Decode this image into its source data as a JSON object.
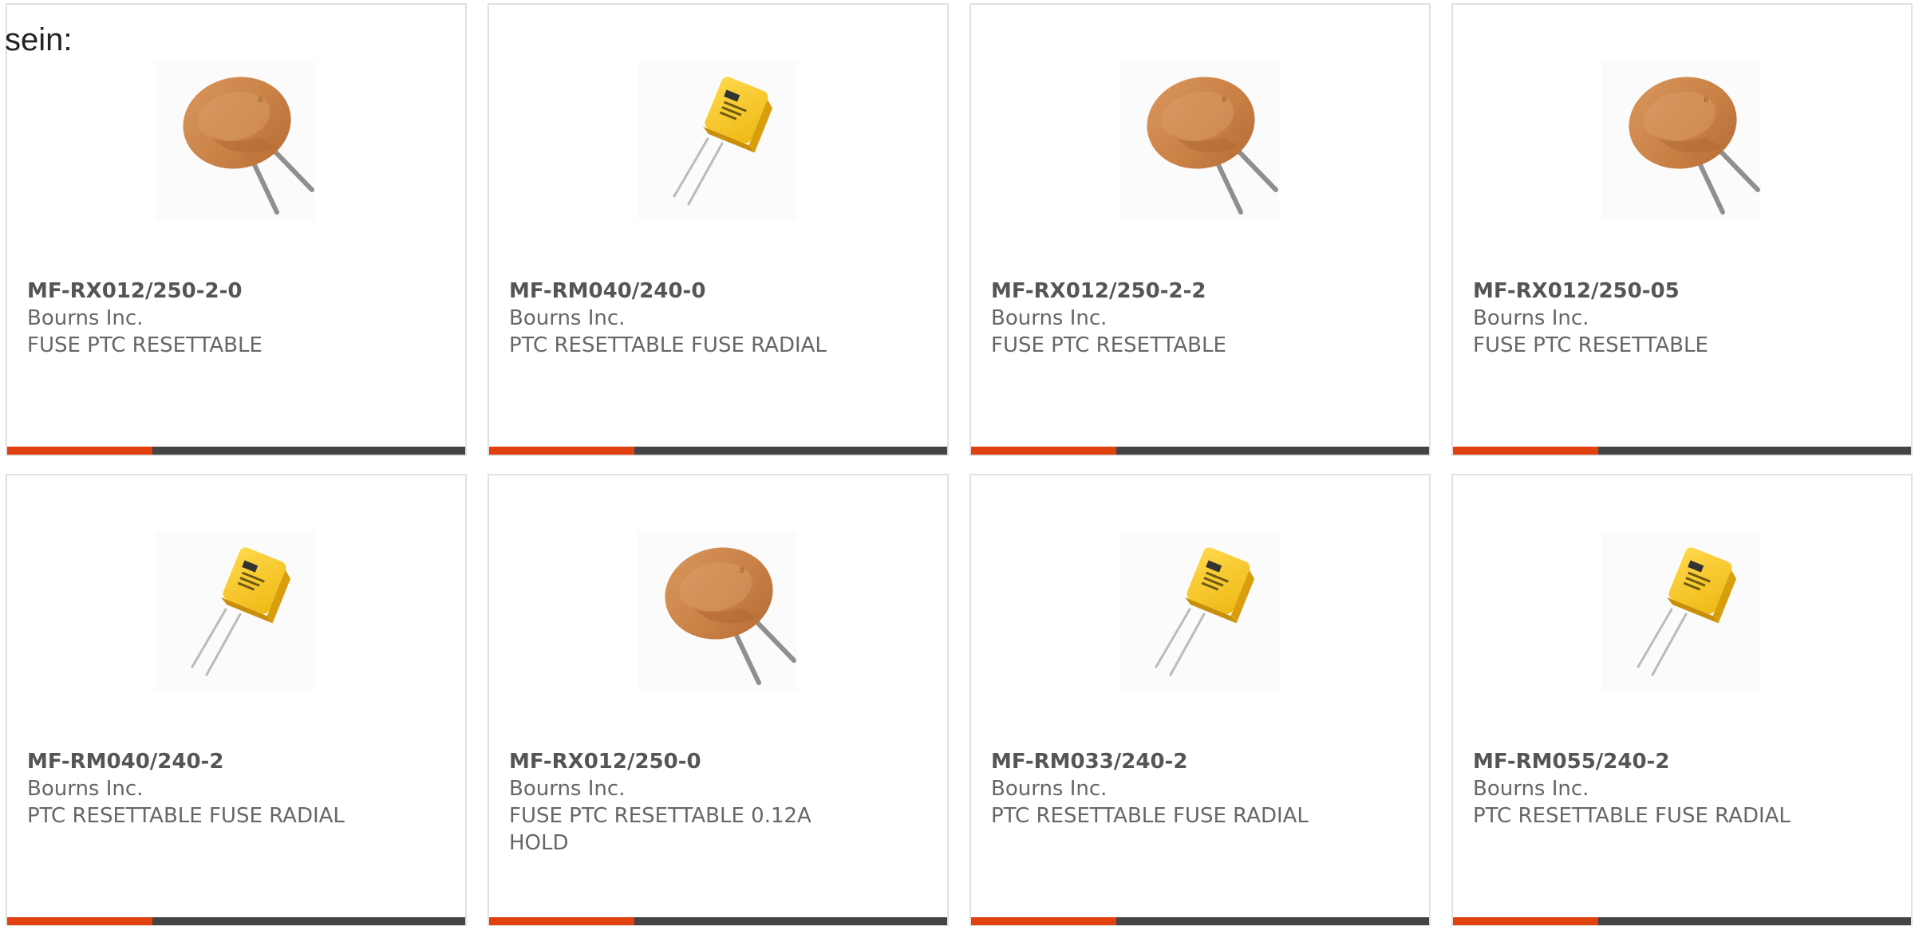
{
  "intro_text": "sein:",
  "colors": {
    "accent": "#e1400f",
    "bar": "#444444",
    "border": "#e1e1e1",
    "text": "#666666"
  },
  "products": [
    {
      "part_number": "MF-RX012/250-2-0",
      "manufacturer": "Bourns Inc.",
      "description": "FUSE PTC RESETTABLE",
      "image": "disc-fuse-icon"
    },
    {
      "part_number": "MF-RM040/240-0",
      "manufacturer": "Bourns Inc.",
      "description": "PTC RESETTABLE FUSE RADIAL",
      "image": "radial-fuse-icon"
    },
    {
      "part_number": "MF-RX012/250-2-2",
      "manufacturer": "Bourns Inc.",
      "description": "FUSE PTC RESETTABLE",
      "image": "disc-fuse-icon"
    },
    {
      "part_number": "MF-RX012/250-05",
      "manufacturer": "Bourns Inc.",
      "description": "FUSE PTC RESETTABLE",
      "image": "disc-fuse-icon"
    },
    {
      "part_number": "MF-RM040/240-2",
      "manufacturer": "Bourns Inc.",
      "description": "PTC RESETTABLE FUSE RADIAL",
      "image": "radial-fuse-icon"
    },
    {
      "part_number": "MF-RX012/250-0",
      "manufacturer": "Bourns Inc.",
      "description": "FUSE PTC RESETTABLE 0.12A HOLD",
      "image": "disc-fuse-icon"
    },
    {
      "part_number": "MF-RM033/240-2",
      "manufacturer": "Bourns Inc.",
      "description": "PTC RESETTABLE FUSE RADIAL",
      "image": "radial-fuse-icon"
    },
    {
      "part_number": "MF-RM055/240-2",
      "manufacturer": "Bourns Inc.",
      "description": "PTC RESETTABLE FUSE RADIAL",
      "image": "radial-fuse-icon"
    }
  ]
}
